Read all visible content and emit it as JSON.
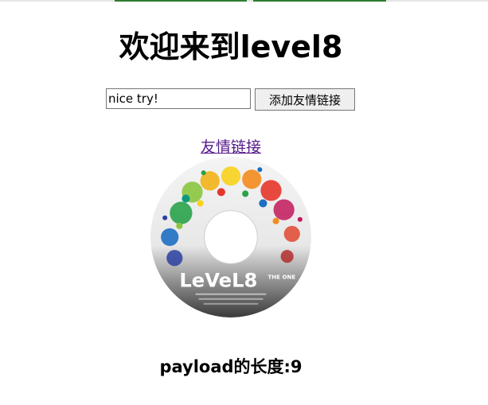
{
  "heading": "欢迎来到level8",
  "form": {
    "input_value": "nice try!",
    "button_label": "添加友情链接"
  },
  "link": {
    "label": "友情链接"
  },
  "image": {
    "logo_text": "LeVeL8",
    "logo_sub": "THE ONE"
  },
  "payload_text": "payload的长度:9",
  "colors": {
    "link": "#551a8b",
    "topbar_accent": "#2e7d32"
  }
}
